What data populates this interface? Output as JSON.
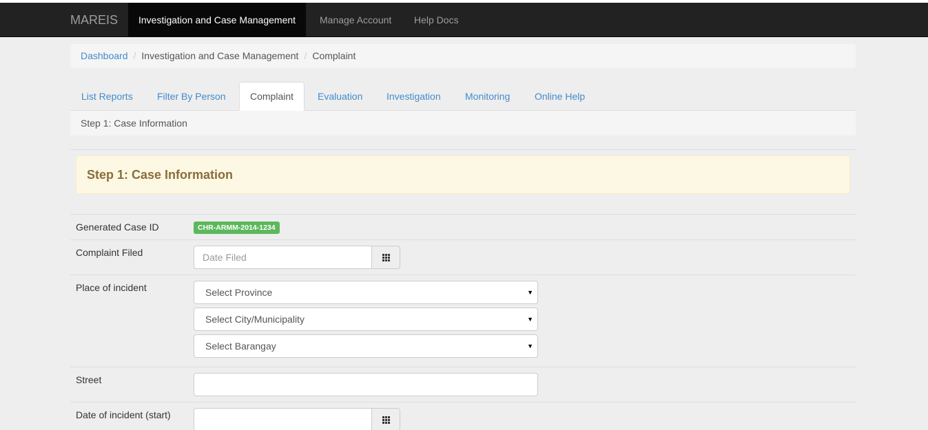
{
  "navbar": {
    "brand": "MAREIS",
    "items": [
      {
        "label": "Investigation and Case Management",
        "active": true
      },
      {
        "label": "Manage Account",
        "active": false
      },
      {
        "label": "Help Docs",
        "active": false
      }
    ]
  },
  "breadcrumb": {
    "items": [
      "Dashboard",
      "Investigation and Case Management",
      "Complaint"
    ]
  },
  "tabs": [
    "List Reports",
    "Filter By Person",
    "Complaint",
    "Evaluation",
    "Investigation",
    "Monitoring",
    "Online Help"
  ],
  "step_bar": "Step 1: Case Information",
  "panel_title": "Step 1: Case Information",
  "form": {
    "case_id_label": "Generated Case ID",
    "case_id_value": "CHR-ARMM-2014-1234",
    "complaint_filed_label": "Complaint Filed",
    "date_filed_placeholder": "Date Filed",
    "place_label": "Place of incident",
    "province_select": "Select Province",
    "city_select": "Select City/Municipality",
    "barangay_select": "Select Barangay",
    "street_label": "Street",
    "date_start_label": "Date of incident (start)"
  },
  "icons": {
    "calendar": "calendar-grid-icon",
    "select_caret": "caret-down-icon"
  },
  "colors": {
    "navbar_bg": "#222222",
    "link": "#428bca",
    "badge_success": "#5cb85c",
    "alert_bg": "#fcf8e3",
    "alert_text": "#8a6d3b"
  }
}
